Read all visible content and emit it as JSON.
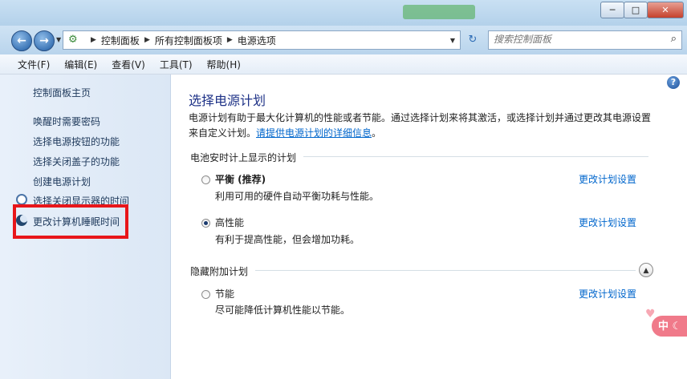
{
  "window": {
    "minimize_glyph": "─",
    "maximize_glyph": "□",
    "close_glyph": "✕"
  },
  "nav": {
    "back_glyph": "←",
    "forward_glyph": "→",
    "dropdown_glyph": "▼",
    "refresh_glyph": "↻"
  },
  "address": {
    "breadcrumbs": [
      "控制面板",
      "所有控制面板项",
      "电源选项"
    ],
    "separator": "▶"
  },
  "search": {
    "placeholder": "搜索控制面板",
    "icon": "search-icon",
    "glyph": "⌕"
  },
  "menu": [
    "文件(F)",
    "编辑(E)",
    "查看(V)",
    "工具(T)",
    "帮助(H)"
  ],
  "sidebar": {
    "home": "控制面板主页",
    "items": [
      {
        "label": "唤醒时需要密码",
        "icon": null
      },
      {
        "label": "选择电源按钮的功能",
        "icon": null
      },
      {
        "label": "选择关闭盖子的功能",
        "icon": null
      },
      {
        "label": "创建电源计划",
        "icon": null
      },
      {
        "label": "选择关闭显示器的时间",
        "icon": "clock-icon"
      },
      {
        "label": "更改计算机睡眠时间",
        "icon": "moon-icon"
      }
    ]
  },
  "main": {
    "help_glyph": "?",
    "title": "选择电源计划",
    "description": "电源计划有助于最大化计算机的性能或者节能。通过选择计划来将其激活，或选择计划并通过更改其电源设置来自定义计划。",
    "description_link": "请提供电源计划的详细信息",
    "description_end": "。",
    "group_battery": "电池安时计上显示的计划",
    "group_hidden": "隐藏附加计划",
    "collapse_glyph": "▲",
    "plans": [
      {
        "name": "平衡 (推荐)",
        "desc": "利用可用的硬件自动平衡功耗与性能。",
        "selected": false,
        "link": "更改计划设置"
      },
      {
        "name": "高性能",
        "desc": "有利于提高性能，但会增加功耗。",
        "selected": true,
        "link": "更改计划设置"
      },
      {
        "name": "节能",
        "desc": "尽可能降低计算机性能以节能。",
        "selected": false,
        "link": "更改计划设置"
      }
    ]
  },
  "ime": {
    "label": "中",
    "glyph": "☾"
  },
  "colors": {
    "highlight_box": "#e8161a",
    "link": "#0066cc",
    "heading": "#1e3287"
  }
}
